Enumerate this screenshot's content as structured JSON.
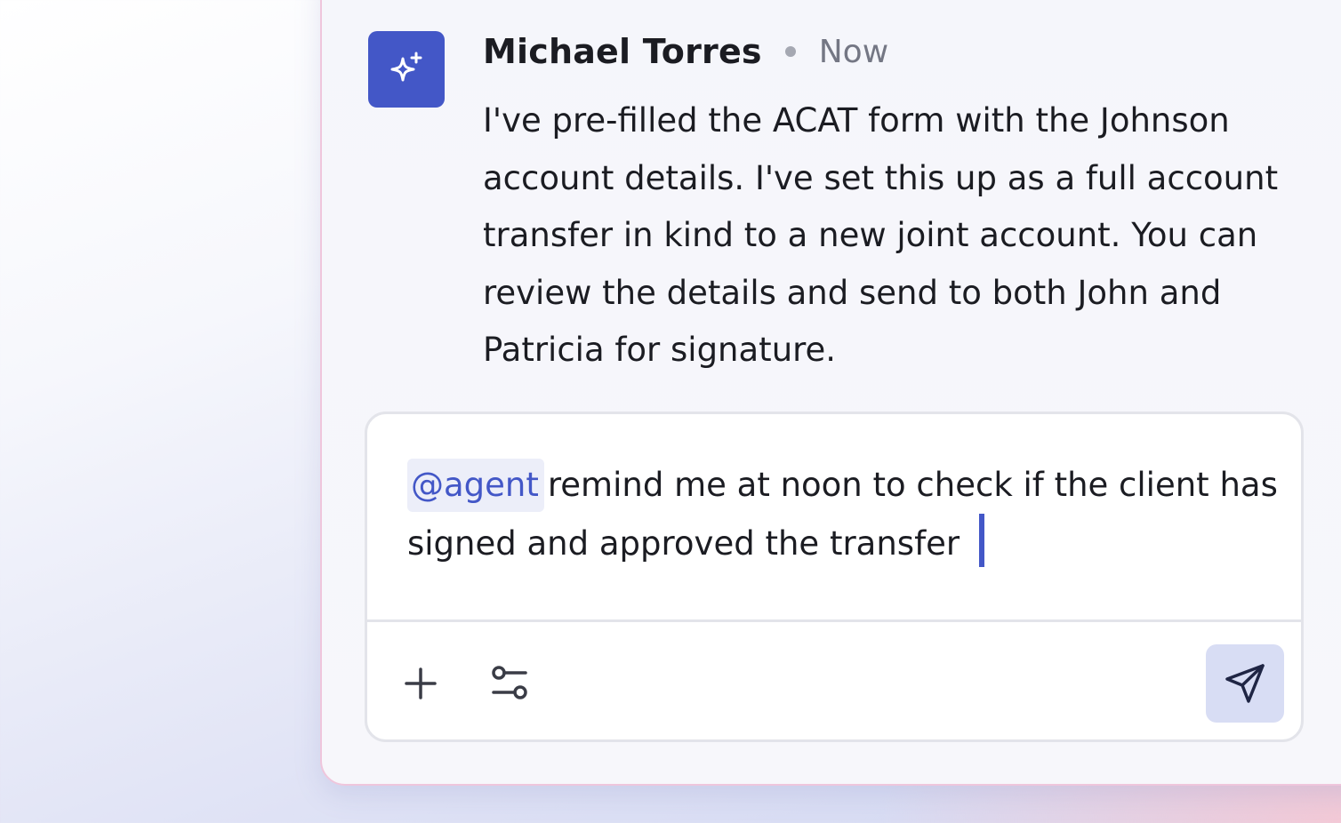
{
  "message": {
    "author": "Michael Torres",
    "timestamp": "Now",
    "avatar_icon": "sparkle-icon",
    "body": "I've pre-filled the ACAT form with the Johnson account details. I've set this up as a full account transfer in kind to a new joint account. You can review the details and send to both John and Patricia for signature."
  },
  "composer": {
    "mention": "@agent",
    "text": "remind me at noon to check if the client has signed and approved the transfer",
    "add_icon": "plus-icon",
    "settings_icon": "sliders-icon",
    "send_icon": "send-icon"
  },
  "colors": {
    "accent": "#4357c7",
    "send_button_bg": "#d8ddf4",
    "panel_border": "#efc6dc"
  }
}
